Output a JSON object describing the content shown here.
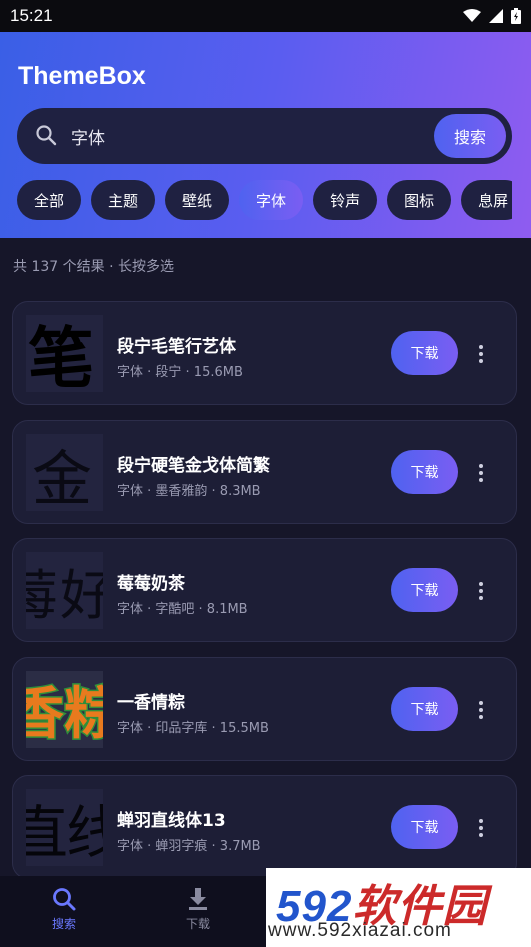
{
  "status_bar": {
    "time": "15:21"
  },
  "app": {
    "title": "ThemeBox"
  },
  "search": {
    "query": "字体",
    "button_label": "搜索"
  },
  "categories": [
    "全部",
    "主题",
    "壁纸",
    "字体",
    "铃声",
    "图标",
    "息屏"
  ],
  "active_category": "字体",
  "results": {
    "summary": "共 137 个结果 · 长按多选"
  },
  "items": [
    {
      "title": "段宁毛笔行艺体",
      "meta": "字体 · 段宁 · 15.6MB",
      "download_label": "下载",
      "thumb_glyph": "笔"
    },
    {
      "title": "段宁硬笔金戈体简繁",
      "meta": "字体 · 墨香雅韵 · 8.3MB",
      "download_label": "下载",
      "thumb_glyph": "金"
    },
    {
      "title": "莓莓奶茶",
      "meta": "字体 · 字酷吧 · 8.1MB",
      "download_label": "下载",
      "thumb_glyph": "莓 好"
    },
    {
      "title": "一香情粽",
      "meta": "字体 · 印品字库 · 15.5MB",
      "download_label": "下载",
      "thumb_glyph": "香 粽"
    },
    {
      "title": "蝉羽直线体13",
      "meta": "字体 · 蝉羽字痕 · 3.7MB",
      "download_label": "下载",
      "thumb_glyph": "直 线"
    }
  ],
  "bottom_nav": [
    {
      "label": "搜索",
      "icon": "search-icon",
      "active": true
    },
    {
      "label": "下载",
      "icon": "download-icon",
      "active": false
    }
  ],
  "watermark": {
    "title_num": "592",
    "title_cn": "软件园",
    "url": "www.592xiazai.com"
  },
  "colors": {
    "accent": "#5a5df0",
    "background": "#161629",
    "card": "#1d1e36"
  }
}
